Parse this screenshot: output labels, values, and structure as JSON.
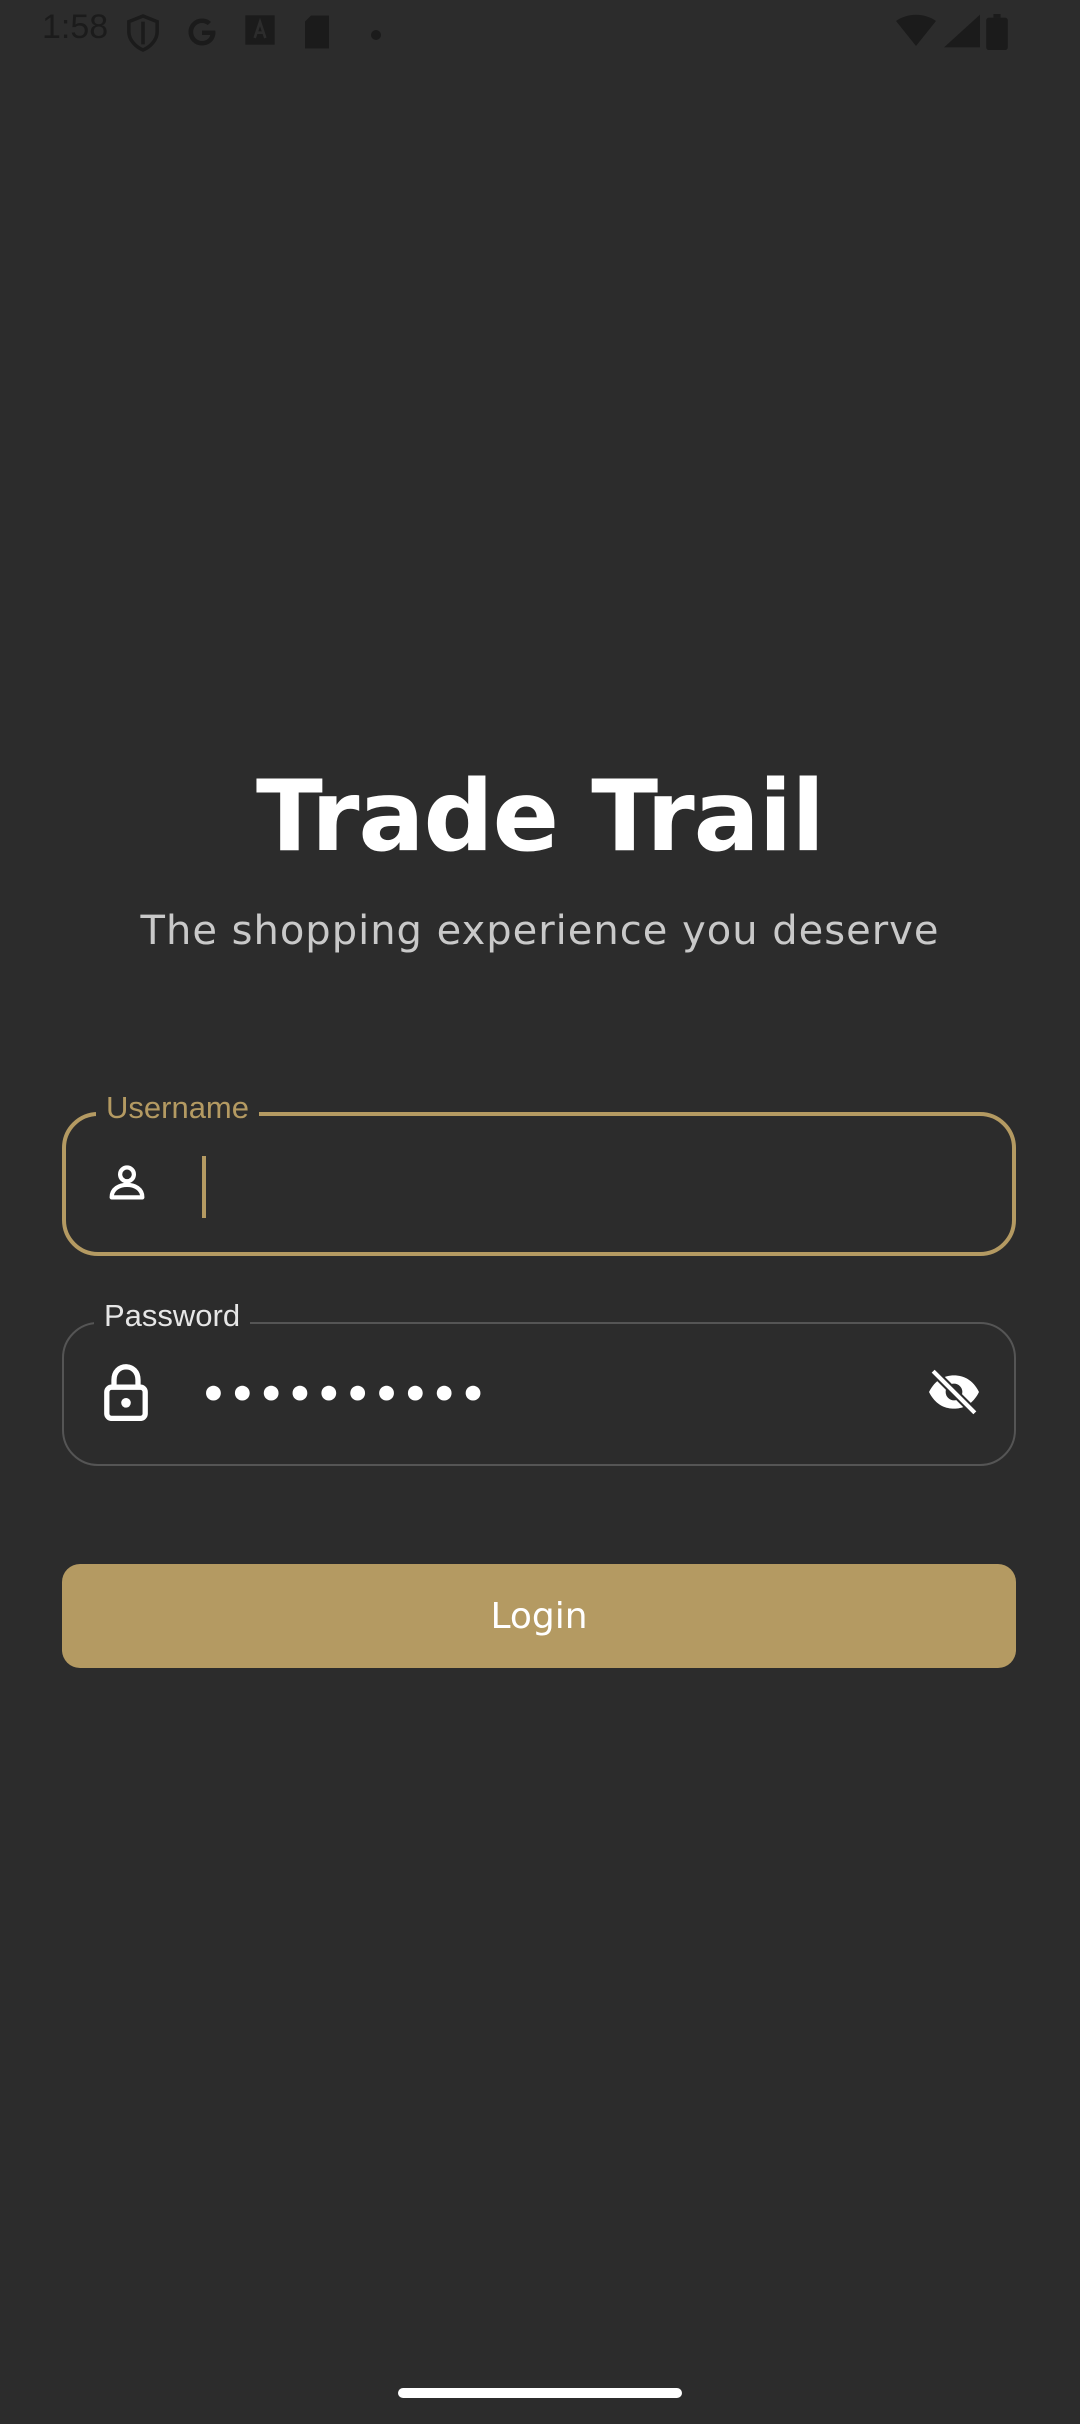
{
  "status_bar": {
    "time": "1:58",
    "icons": [
      "shield-icon",
      "google-icon",
      "font-icon",
      "sd-card-icon",
      "dot-icon",
      "wifi-icon",
      "signal-icon",
      "battery-icon"
    ]
  },
  "app": {
    "title": "Trade Trail",
    "subtitle": "The shopping experience you deserve"
  },
  "form": {
    "username": {
      "label": "Username",
      "value": "",
      "icon": "person-icon"
    },
    "password": {
      "label": "Password",
      "value": "••••••••••",
      "icon": "lock-icon",
      "toggle_icon": "eye-off-icon"
    },
    "login_label": "Login"
  },
  "colors": {
    "background": "#2c2c2c",
    "accent": "#b49a62",
    "text": "#ffffff",
    "subtext": "#c9c9c9"
  }
}
